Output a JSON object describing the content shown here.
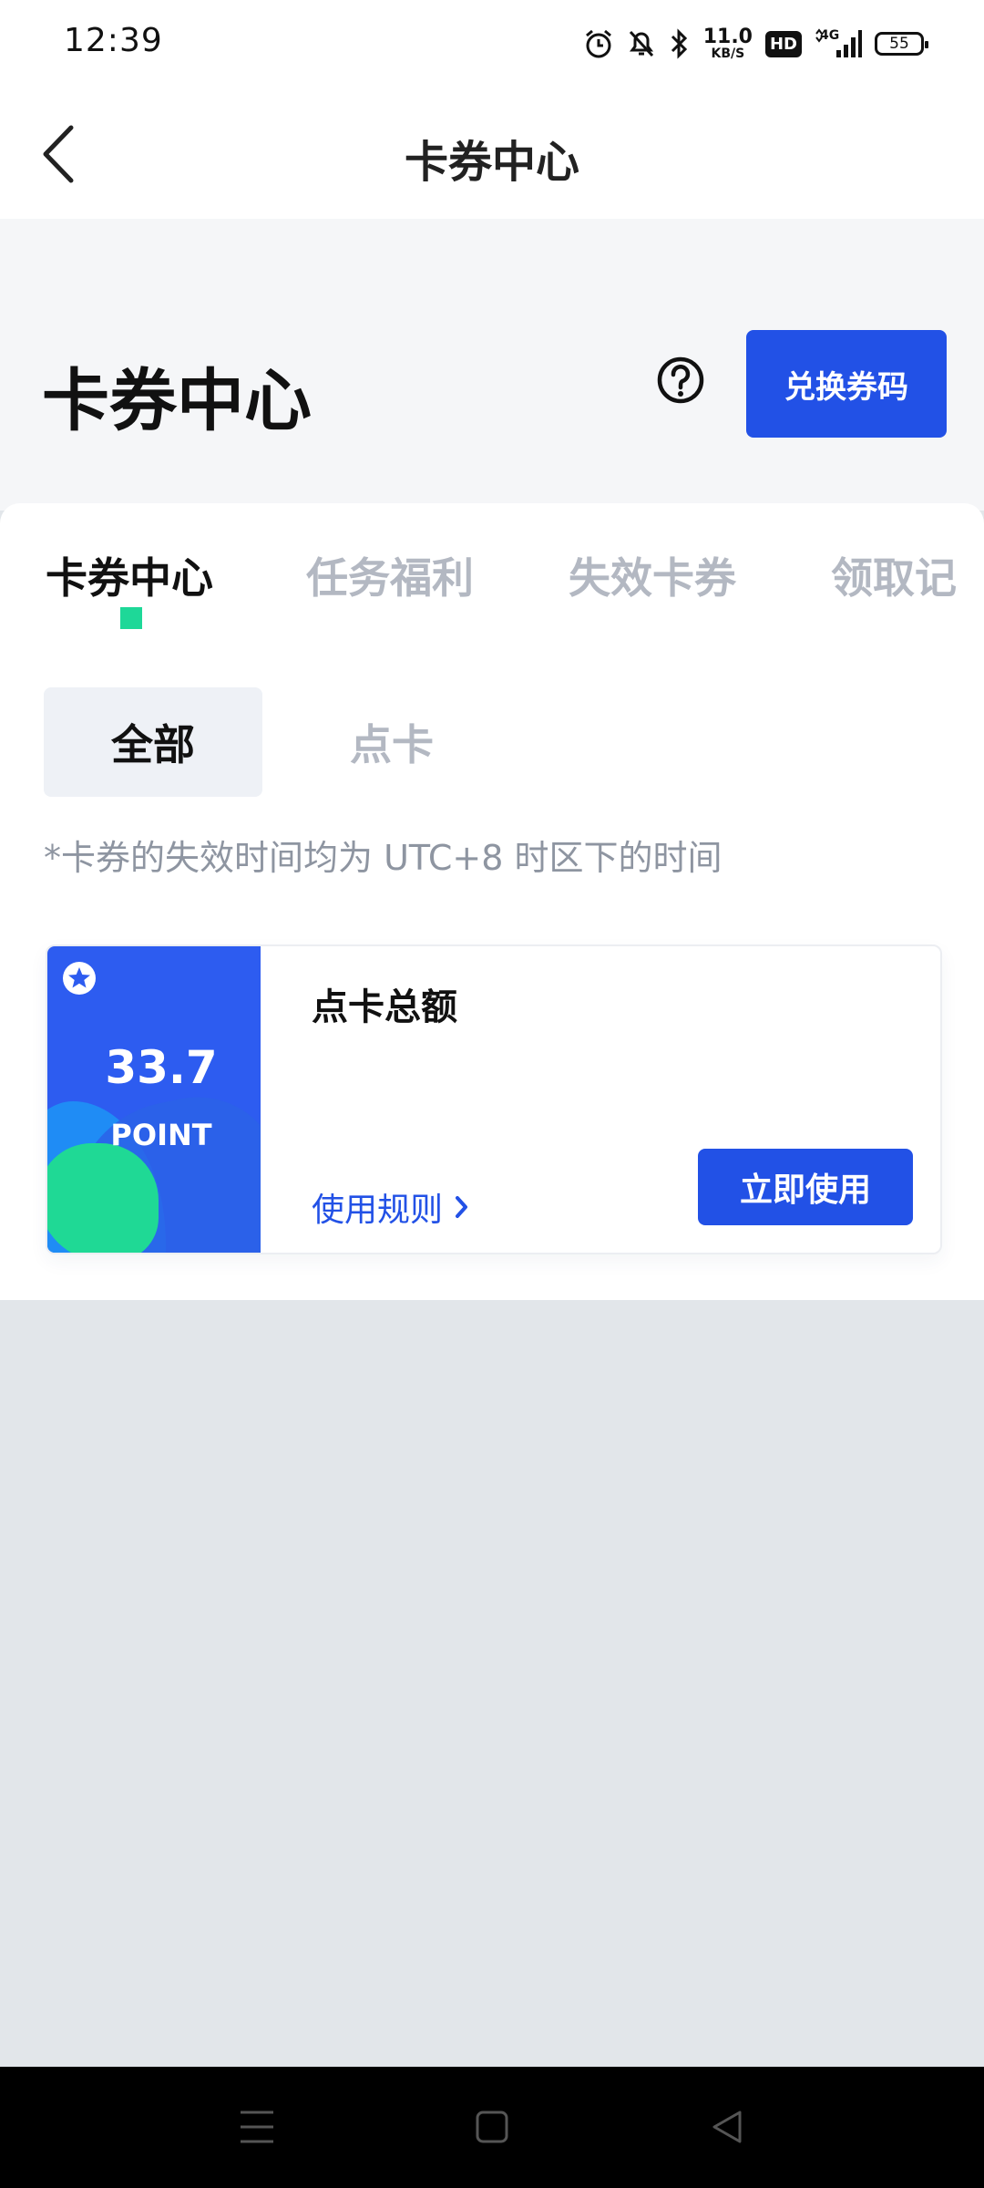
{
  "status_bar": {
    "time": "12:39",
    "net_speed_value": "11.0",
    "net_speed_unit": "KB/S",
    "hd": "HD",
    "signal": "4G",
    "battery": "55",
    "icons": [
      "alarm-icon",
      "silent-bell-icon",
      "bluetooth-icon",
      "signal-icon",
      "battery-icon"
    ]
  },
  "nav": {
    "title": "卡券中心",
    "back_icon": "chevron-left-icon"
  },
  "header": {
    "title": "卡券中心",
    "help_icon": "question-circle-icon",
    "redeem_label": "兑换券码"
  },
  "tabs": [
    {
      "label": "卡券中心",
      "active": true
    },
    {
      "label": "任务福利",
      "active": false
    },
    {
      "label": "失效卡券",
      "active": false
    },
    {
      "label": "领取记",
      "active": false
    }
  ],
  "filters": [
    {
      "label": "全部",
      "selected": true
    },
    {
      "label": "点卡",
      "selected": false
    }
  ],
  "notice": "*卡券的失效时间均为 UTC+8 时区下的时间",
  "coupon": {
    "amount": "33.7",
    "unit": "POINT",
    "title": "点卡总额",
    "rules_label": "使用规则",
    "use_label": "立即使用",
    "star_icon": "star-badge-icon"
  },
  "colors": {
    "accent": "#2251e6",
    "indicator": "#1ed898",
    "muted": "#b3b8c2"
  },
  "system_nav": [
    "menu-icon",
    "home-square-icon",
    "back-triangle-icon"
  ]
}
